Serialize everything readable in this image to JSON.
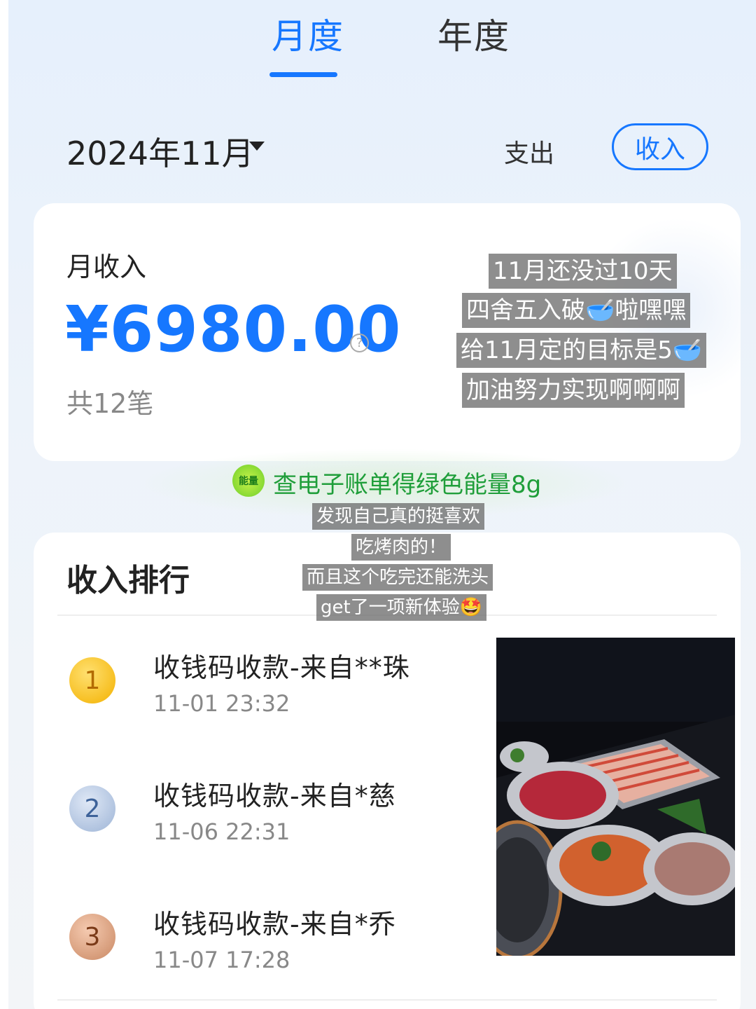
{
  "tabs": {
    "monthly": "月度",
    "yearly": "年度"
  },
  "month_picker": {
    "label": "2024年11月"
  },
  "toggle": {
    "expense": "支出",
    "income": "收入"
  },
  "summary": {
    "label": "月收入",
    "amount": "¥6980.00",
    "help_icon_glyph": "?",
    "count": "共12笔"
  },
  "energy": {
    "icon_text": "能量",
    "text": "查电子账单得绿色能量8g"
  },
  "ranking": {
    "title": "收入排行",
    "items": [
      {
        "rank": "1",
        "name": "收钱码收款-来自**珠",
        "time": "11-01 23:32"
      },
      {
        "rank": "2",
        "name": "收钱码收款-来自*慈",
        "time": "11-06 22:31"
      },
      {
        "rank": "3",
        "name": "收钱码收款-来自*乔",
        "time": "11-07 17:28"
      }
    ]
  },
  "overlay_text": {
    "line1": "11月还没过10天",
    "line2": "四舍五入破🥣啦嘿嘿",
    "line3": "给11月定的目标是5🥣",
    "line4": "加油努力实现啊啊啊",
    "line5": "发现自己真的挺喜欢",
    "line6": "吃烤肉的！",
    "line7": "而且这个吃完还能洗头",
    "line8": "get了一项新体验🤩"
  },
  "colors": {
    "accent": "#1677ff",
    "energy_green": "#1f9e3a"
  },
  "photo": {
    "description_icon": "bbq-photo"
  }
}
